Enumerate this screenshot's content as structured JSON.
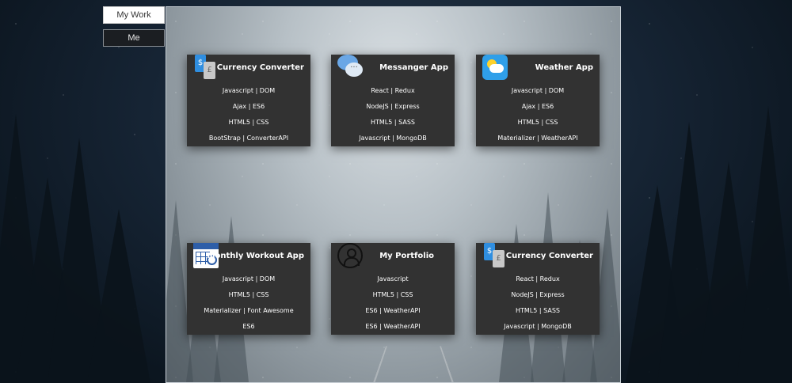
{
  "nav": {
    "my_work": "My Work",
    "me": "Me"
  },
  "cards": [
    {
      "title": "Currency Converter",
      "icon": "currency-exchange-icon",
      "tech": [
        "Javascript | DOM",
        "Ajax | ES6",
        "HTML5 | CSS",
        "BootStrap | ConverterAPI"
      ]
    },
    {
      "title": "Messanger App",
      "icon": "chat-bubbles-icon",
      "tech": [
        "React | Redux",
        "NodeJS | Express",
        "HTML5 | SASS",
        "Javascript | MongoDB"
      ]
    },
    {
      "title": "Weather App",
      "icon": "weather-icon",
      "tech": [
        "Javascript | DOM",
        "Ajax | ES6",
        "HTML5 | CSS",
        "Materializer | WeatherAPI"
      ]
    },
    {
      "title": "Monthly Workout App",
      "icon": "calendar-clock-icon",
      "tech": [
        "Javascript | DOM",
        "HTML5 | CSS",
        "Materializer | Font Awesome",
        "ES6"
      ]
    },
    {
      "title": "My Portfolio",
      "icon": "user-icon",
      "tech": [
        "Javascript",
        "HTML5 | CSS",
        "ES6 | WeatherAPI",
        "ES6 | WeatherAPI"
      ]
    },
    {
      "title": "Currency Converter",
      "icon": "currency-exchange-icon",
      "tech": [
        "React | Redux",
        "NodeJS | Express",
        "HTML5 | SASS",
        "Javascript | MongoDB"
      ]
    }
  ]
}
